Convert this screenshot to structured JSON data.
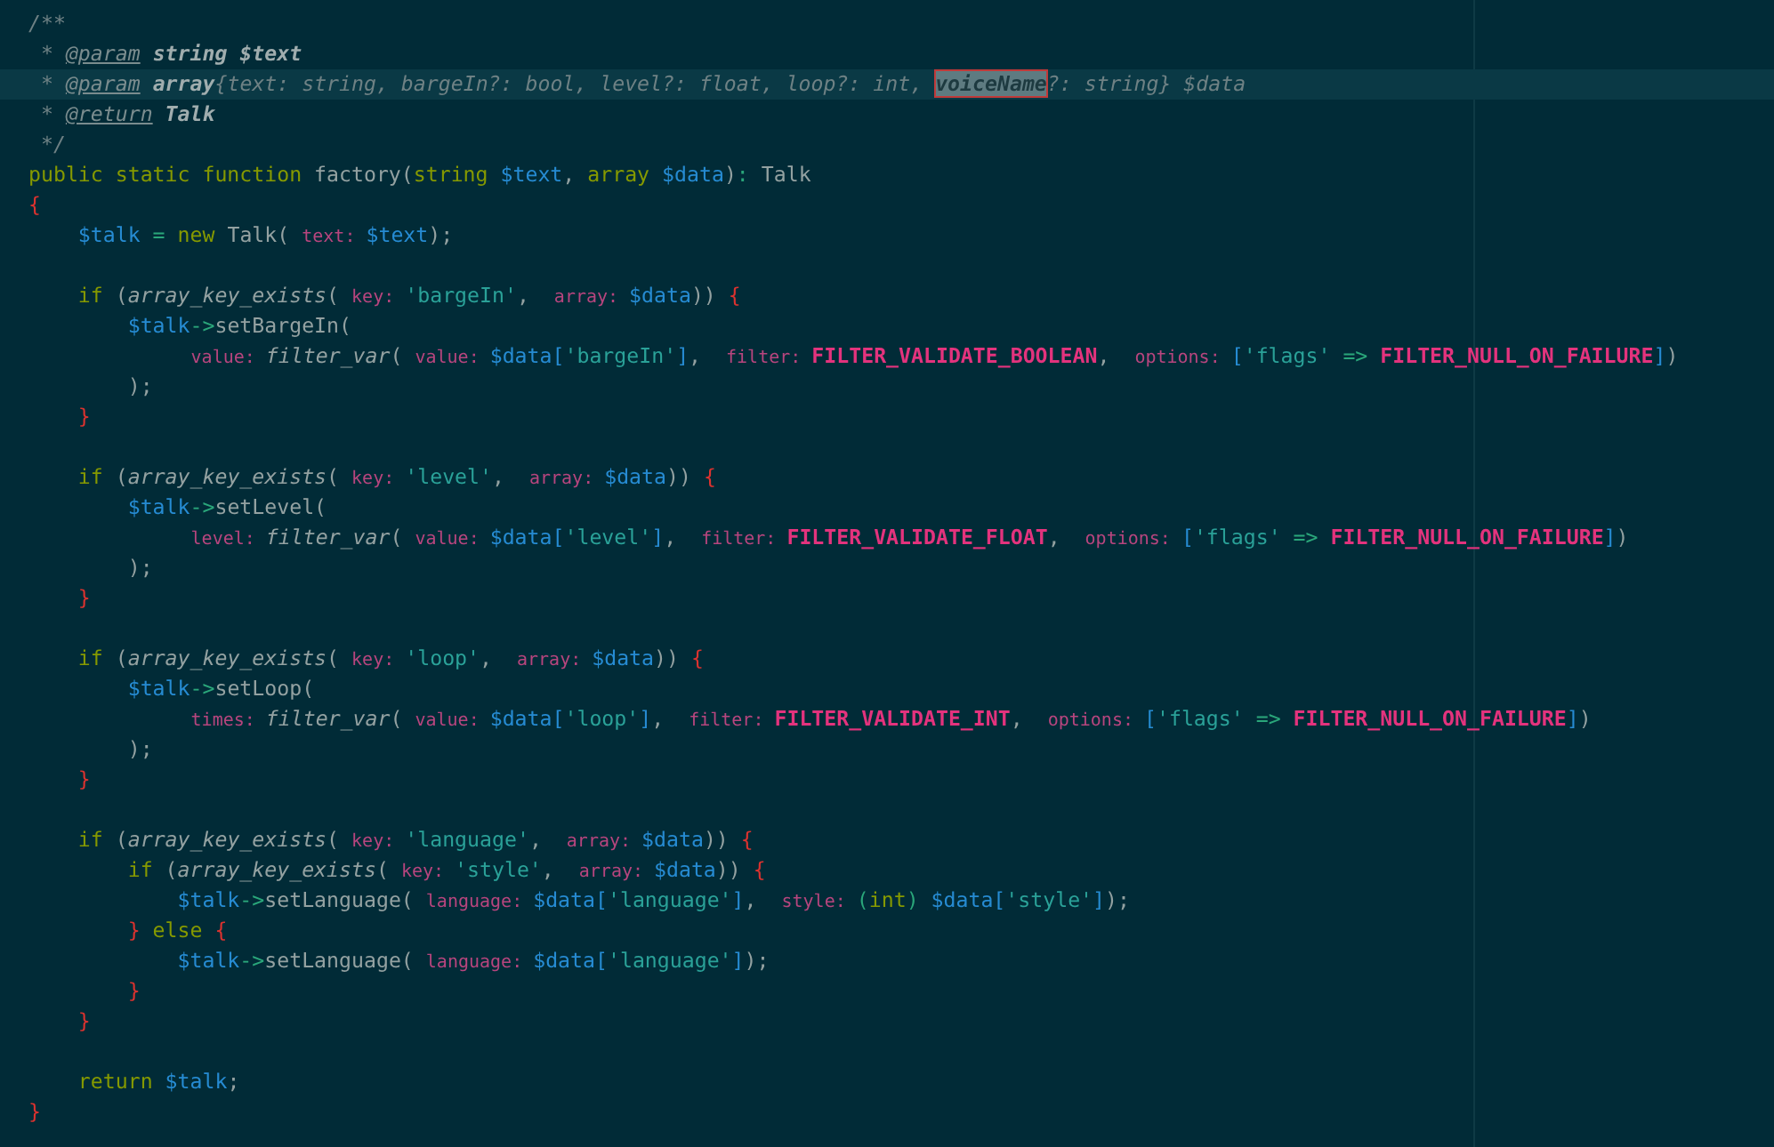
{
  "editor": {
    "lines": [
      {
        "current": false,
        "tokens": [
          {
            "kind": "comment",
            "text": "/**"
          }
        ]
      },
      {
        "current": false,
        "tokens": [
          {
            "kind": "comment",
            "text": " * "
          },
          {
            "kind": "doc-tag",
            "text": "@param"
          },
          {
            "kind": "doc-type",
            "text": " string $text"
          }
        ]
      },
      {
        "current": true,
        "tokens": [
          {
            "kind": "comment",
            "text": " * "
          },
          {
            "kind": "doc-tag",
            "text": "@param"
          },
          {
            "kind": "doc-type",
            "text": " array"
          },
          {
            "kind": "comment",
            "text": "{text: string, bargeIn?: bool, level?: float, loop?: int, "
          },
          {
            "kind": "match",
            "text": "voiceName"
          },
          {
            "kind": "comment",
            "text": "?: string} $data"
          }
        ]
      },
      {
        "current": false,
        "tokens": [
          {
            "kind": "comment",
            "text": " * "
          },
          {
            "kind": "doc-tag",
            "text": "@return"
          },
          {
            "kind": "doc-type",
            "text": " Talk"
          }
        ]
      },
      {
        "current": false,
        "tokens": [
          {
            "kind": "comment",
            "text": " */"
          }
        ]
      },
      {
        "current": false,
        "tokens": [
          {
            "kind": "keyword",
            "text": "public static function"
          },
          {
            "kind": "plain",
            "text": " factory("
          },
          {
            "kind": "keyword",
            "text": "string"
          },
          {
            "kind": "variable",
            "text": " $text"
          },
          {
            "kind": "plain",
            "text": ", "
          },
          {
            "kind": "keyword",
            "text": "array"
          },
          {
            "kind": "variable",
            "text": " $data"
          },
          {
            "kind": "plain",
            "text": ")"
          },
          {
            "kind": "operator",
            "text": ":"
          },
          {
            "kind": "plain",
            "text": " Talk"
          }
        ]
      },
      {
        "current": false,
        "tokens": [
          {
            "kind": "brace",
            "text": "{"
          }
        ]
      },
      {
        "current": false,
        "tokens": [
          {
            "kind": "variable",
            "text": "    $talk"
          },
          {
            "kind": "operator",
            "text": " = "
          },
          {
            "kind": "keyword",
            "text": "new"
          },
          {
            "kind": "plain",
            "text": " Talk("
          },
          {
            "kind": "hint",
            "text": "text:"
          },
          {
            "kind": "variable",
            "text": "$text"
          },
          {
            "kind": "plain",
            "text": ");"
          }
        ]
      },
      {
        "current": false
      },
      {
        "current": false,
        "tokens": [
          {
            "kind": "keyword",
            "text": "    if"
          },
          {
            "kind": "plain",
            "text": " ("
          },
          {
            "kind": "call",
            "text": "array_key_exists"
          },
          {
            "kind": "plain",
            "text": "("
          },
          {
            "kind": "hint",
            "text": "key:"
          },
          {
            "kind": "string",
            "text": "'bargeIn'"
          },
          {
            "kind": "plain",
            "text": ", "
          },
          {
            "kind": "hint",
            "text": "array:"
          },
          {
            "kind": "variable",
            "text": "$data"
          },
          {
            "kind": "plain",
            "text": "))"
          },
          {
            "kind": "brace",
            "text": " {"
          }
        ]
      },
      {
        "current": false,
        "tokens": [
          {
            "kind": "variable",
            "text": "        $talk"
          },
          {
            "kind": "operator",
            "text": "->"
          },
          {
            "kind": "plain",
            "text": "setBargeIn("
          }
        ]
      },
      {
        "current": false,
        "tokens": [
          {
            "kind": "hint",
            "text": "              value:"
          },
          {
            "kind": "call",
            "text": "filter_var"
          },
          {
            "kind": "plain",
            "text": "("
          },
          {
            "kind": "hint",
            "text": "value:"
          },
          {
            "kind": "variable",
            "text": "$data["
          },
          {
            "kind": "string",
            "text": "'bargeIn'"
          },
          {
            "kind": "variable",
            "text": "]"
          },
          {
            "kind": "plain",
            "text": ", "
          },
          {
            "kind": "hint",
            "text": "filter:"
          },
          {
            "kind": "constant",
            "text": "FILTER_VALIDATE_BOOLEAN"
          },
          {
            "kind": "plain",
            "text": ", "
          },
          {
            "kind": "hint",
            "text": "options:"
          },
          {
            "kind": "variable",
            "text": "["
          },
          {
            "kind": "string",
            "text": "'flags'"
          },
          {
            "kind": "operator",
            "text": " => "
          },
          {
            "kind": "constant",
            "text": "FILTER_NULL_ON_FAILURE"
          },
          {
            "kind": "variable",
            "text": "]"
          },
          {
            "kind": "plain",
            "text": ")"
          }
        ]
      },
      {
        "current": false,
        "tokens": [
          {
            "kind": "plain",
            "text": "        );"
          }
        ]
      },
      {
        "current": false,
        "tokens": [
          {
            "kind": "brace",
            "text": "    }"
          }
        ]
      },
      {
        "current": false
      },
      {
        "current": false,
        "tokens": [
          {
            "kind": "keyword",
            "text": "    if"
          },
          {
            "kind": "plain",
            "text": " ("
          },
          {
            "kind": "call",
            "text": "array_key_exists"
          },
          {
            "kind": "plain",
            "text": "("
          },
          {
            "kind": "hint",
            "text": "key:"
          },
          {
            "kind": "string",
            "text": "'level'"
          },
          {
            "kind": "plain",
            "text": ", "
          },
          {
            "kind": "hint",
            "text": "array:"
          },
          {
            "kind": "variable",
            "text": "$data"
          },
          {
            "kind": "plain",
            "text": "))"
          },
          {
            "kind": "brace",
            "text": " {"
          }
        ]
      },
      {
        "current": false,
        "tokens": [
          {
            "kind": "variable",
            "text": "        $talk"
          },
          {
            "kind": "operator",
            "text": "->"
          },
          {
            "kind": "plain",
            "text": "setLevel("
          }
        ]
      },
      {
        "current": false,
        "tokens": [
          {
            "kind": "hint",
            "text": "              level:"
          },
          {
            "kind": "call",
            "text": "filter_var"
          },
          {
            "kind": "plain",
            "text": "("
          },
          {
            "kind": "hint",
            "text": "value:"
          },
          {
            "kind": "variable",
            "text": "$data["
          },
          {
            "kind": "string",
            "text": "'level'"
          },
          {
            "kind": "variable",
            "text": "]"
          },
          {
            "kind": "plain",
            "text": ", "
          },
          {
            "kind": "hint",
            "text": "filter:"
          },
          {
            "kind": "constant",
            "text": "FILTER_VALIDATE_FLOAT"
          },
          {
            "kind": "plain",
            "text": ", "
          },
          {
            "kind": "hint",
            "text": "options:"
          },
          {
            "kind": "variable",
            "text": "["
          },
          {
            "kind": "string",
            "text": "'flags'"
          },
          {
            "kind": "operator",
            "text": " => "
          },
          {
            "kind": "constant",
            "text": "FILTER_NULL_ON_FAILURE"
          },
          {
            "kind": "variable",
            "text": "]"
          },
          {
            "kind": "plain",
            "text": ")"
          }
        ]
      },
      {
        "current": false,
        "tokens": [
          {
            "kind": "plain",
            "text": "        );"
          }
        ]
      },
      {
        "current": false,
        "tokens": [
          {
            "kind": "brace",
            "text": "    }"
          }
        ]
      },
      {
        "current": false
      },
      {
        "current": false,
        "tokens": [
          {
            "kind": "keyword",
            "text": "    if"
          },
          {
            "kind": "plain",
            "text": " ("
          },
          {
            "kind": "call",
            "text": "array_key_exists"
          },
          {
            "kind": "plain",
            "text": "("
          },
          {
            "kind": "hint",
            "text": "key:"
          },
          {
            "kind": "string",
            "text": "'loop'"
          },
          {
            "kind": "plain",
            "text": ", "
          },
          {
            "kind": "hint",
            "text": "array:"
          },
          {
            "kind": "variable",
            "text": "$data"
          },
          {
            "kind": "plain",
            "text": "))"
          },
          {
            "kind": "brace",
            "text": " {"
          }
        ]
      },
      {
        "current": false,
        "tokens": [
          {
            "kind": "variable",
            "text": "        $talk"
          },
          {
            "kind": "operator",
            "text": "->"
          },
          {
            "kind": "plain",
            "text": "setLoop("
          }
        ]
      },
      {
        "current": false,
        "tokens": [
          {
            "kind": "hint",
            "text": "              times:"
          },
          {
            "kind": "call",
            "text": "filter_var"
          },
          {
            "kind": "plain",
            "text": "("
          },
          {
            "kind": "hint",
            "text": "value:"
          },
          {
            "kind": "variable",
            "text": "$data["
          },
          {
            "kind": "string",
            "text": "'loop'"
          },
          {
            "kind": "variable",
            "text": "]"
          },
          {
            "kind": "plain",
            "text": ", "
          },
          {
            "kind": "hint",
            "text": "filter:"
          },
          {
            "kind": "constant",
            "text": "FILTER_VALIDATE_INT"
          },
          {
            "kind": "plain",
            "text": ", "
          },
          {
            "kind": "hint",
            "text": "options:"
          },
          {
            "kind": "variable",
            "text": "["
          },
          {
            "kind": "string",
            "text": "'flags'"
          },
          {
            "kind": "operator",
            "text": " => "
          },
          {
            "kind": "constant",
            "text": "FILTER_NULL_ON_FAILURE"
          },
          {
            "kind": "variable",
            "text": "]"
          },
          {
            "kind": "plain",
            "text": ")"
          }
        ]
      },
      {
        "current": false,
        "tokens": [
          {
            "kind": "plain",
            "text": "        );"
          }
        ]
      },
      {
        "current": false,
        "tokens": [
          {
            "kind": "brace",
            "text": "    }"
          }
        ]
      },
      {
        "current": false
      },
      {
        "current": false,
        "tokens": [
          {
            "kind": "keyword",
            "text": "    if"
          },
          {
            "kind": "plain",
            "text": " ("
          },
          {
            "kind": "call",
            "text": "array_key_exists"
          },
          {
            "kind": "plain",
            "text": "("
          },
          {
            "kind": "hint",
            "text": "key:"
          },
          {
            "kind": "string",
            "text": "'language'"
          },
          {
            "kind": "plain",
            "text": ", "
          },
          {
            "kind": "hint",
            "text": "array:"
          },
          {
            "kind": "variable",
            "text": "$data"
          },
          {
            "kind": "plain",
            "text": "))"
          },
          {
            "kind": "brace",
            "text": " {"
          }
        ]
      },
      {
        "current": false,
        "tokens": [
          {
            "kind": "keyword",
            "text": "        if"
          },
          {
            "kind": "plain",
            "text": " ("
          },
          {
            "kind": "call",
            "text": "array_key_exists"
          },
          {
            "kind": "plain",
            "text": "("
          },
          {
            "kind": "hint",
            "text": "key:"
          },
          {
            "kind": "string",
            "text": "'style'"
          },
          {
            "kind": "plain",
            "text": ", "
          },
          {
            "kind": "hint",
            "text": "array:"
          },
          {
            "kind": "variable",
            "text": "$data"
          },
          {
            "kind": "plain",
            "text": "))"
          },
          {
            "kind": "brace",
            "text": " {"
          }
        ]
      },
      {
        "current": false,
        "tokens": [
          {
            "kind": "variable",
            "text": "            $talk"
          },
          {
            "kind": "operator",
            "text": "->"
          },
          {
            "kind": "plain",
            "text": "setLanguage("
          },
          {
            "kind": "hint",
            "text": "language:"
          },
          {
            "kind": "variable",
            "text": "$data["
          },
          {
            "kind": "string",
            "text": "'language'"
          },
          {
            "kind": "variable",
            "text": "]"
          },
          {
            "kind": "plain",
            "text": ", "
          },
          {
            "kind": "hint",
            "text": "style:"
          },
          {
            "kind": "operator",
            "text": "("
          },
          {
            "kind": "keyword",
            "text": "int"
          },
          {
            "kind": "operator",
            "text": ")"
          },
          {
            "kind": "variable",
            "text": " $data["
          },
          {
            "kind": "string",
            "text": "'style'"
          },
          {
            "kind": "variable",
            "text": "]"
          },
          {
            "kind": "plain",
            "text": ");"
          }
        ]
      },
      {
        "current": false,
        "tokens": [
          {
            "kind": "brace",
            "text": "        }"
          },
          {
            "kind": "keyword",
            "text": " else"
          },
          {
            "kind": "brace",
            "text": " {"
          }
        ]
      },
      {
        "current": false,
        "tokens": [
          {
            "kind": "variable",
            "text": "            $talk"
          },
          {
            "kind": "operator",
            "text": "->"
          },
          {
            "kind": "plain",
            "text": "setLanguage("
          },
          {
            "kind": "hint",
            "text": "language:"
          },
          {
            "kind": "variable",
            "text": "$data["
          },
          {
            "kind": "string",
            "text": "'language'"
          },
          {
            "kind": "variable",
            "text": "]"
          },
          {
            "kind": "plain",
            "text": ");"
          }
        ]
      },
      {
        "current": false,
        "tokens": [
          {
            "kind": "brace",
            "text": "        }"
          }
        ]
      },
      {
        "current": false,
        "tokens": [
          {
            "kind": "brace",
            "text": "    }"
          }
        ]
      },
      {
        "current": false
      },
      {
        "current": false,
        "tokens": [
          {
            "kind": "keyword",
            "text": "    return"
          },
          {
            "kind": "variable",
            "text": " $talk"
          },
          {
            "kind": "plain",
            "text": ";"
          }
        ]
      },
      {
        "current": false,
        "tokens": [
          {
            "kind": "brace",
            "text": "}"
          }
        ]
      }
    ]
  }
}
